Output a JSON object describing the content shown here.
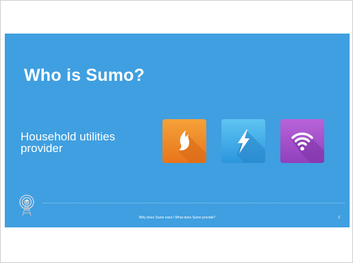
{
  "slide": {
    "title": "Who is Sumo?",
    "subtitle": "Household utilities provider",
    "footer": "Why does Sumo exist / What does Sumo provide?",
    "page_number": "2"
  },
  "icons": [
    "gas-flame-icon",
    "lightning-bolt-icon",
    "wifi-icon",
    "tower-logo-icon"
  ],
  "colors": {
    "slide_background": "#3f9fe0",
    "gas_tile": "#ee8820",
    "electricity_tile": "#3aa9e6",
    "broadband_tile": "#a24ec8"
  }
}
